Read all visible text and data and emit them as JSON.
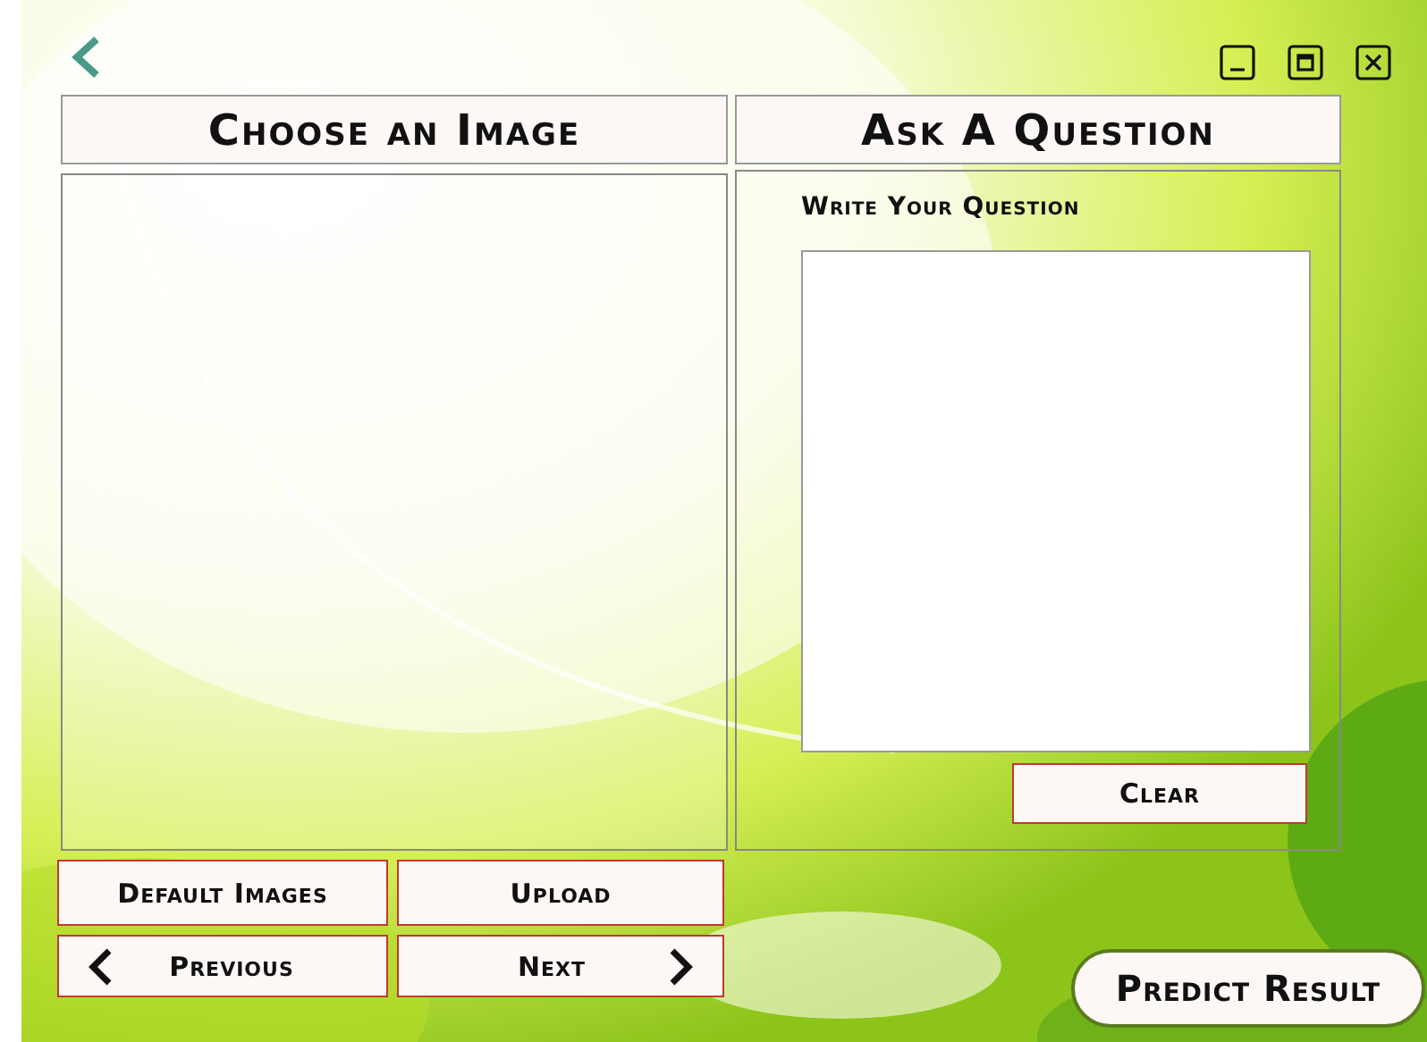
{
  "left_panel": {
    "title": "Choose an Image"
  },
  "right_panel": {
    "title": "Ask A Question",
    "field_label": "Write Your Question",
    "clear_button": "Clear"
  },
  "buttons": [
    {
      "label": "Default Images",
      "kind": "plain"
    },
    {
      "label": "Upload",
      "kind": "plain"
    },
    {
      "label": "Previous",
      "kind": "back"
    },
    {
      "label": "Next",
      "kind": "forward"
    }
  ],
  "predict_button": "Predict Result"
}
